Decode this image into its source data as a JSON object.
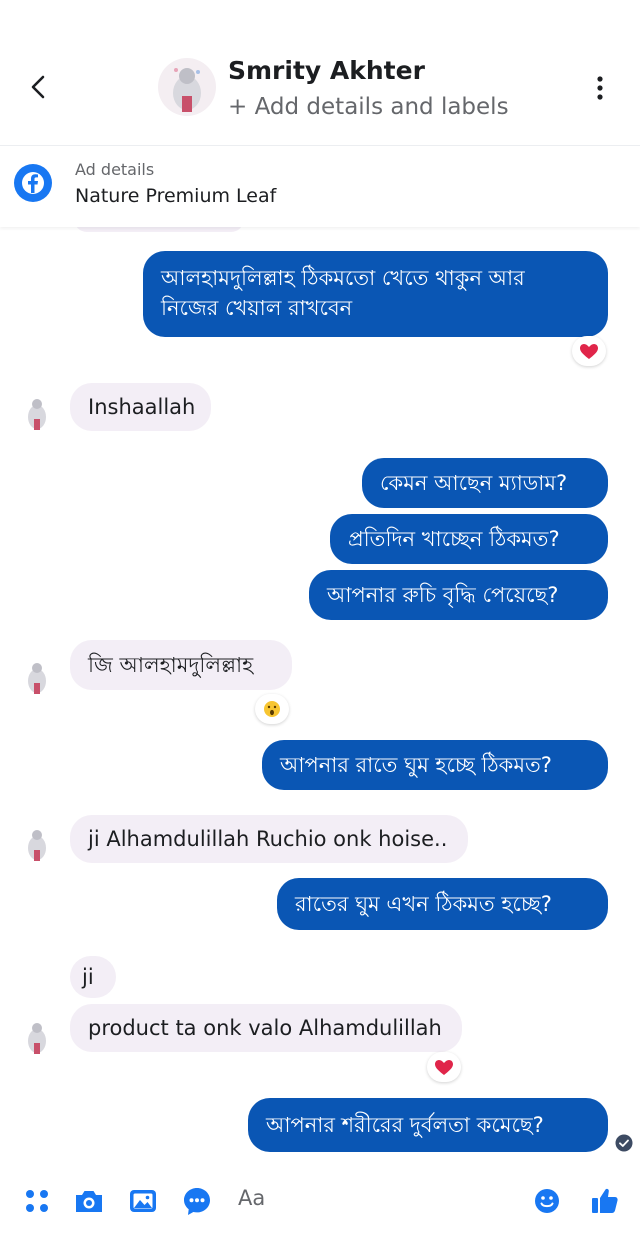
{
  "header": {
    "contact_name": "Smrity Akhter",
    "subtitle": "+ Add details and labels"
  },
  "ad": {
    "label": "Ad details",
    "title": "Nature Premium Leaf"
  },
  "messages": [
    {
      "direction": "outgoing",
      "lines": [
        "আলহামদুলিল্লাহ ঠিকমতো খেতে থাকুন আর",
        "নিজের খেয়াল রাখবেন"
      ],
      "reaction": "heart"
    },
    {
      "direction": "incoming",
      "lines": [
        "Inshaallah"
      ]
    },
    {
      "direction": "outgoing",
      "lines": [
        "কেমন আছেন ম্যাডাম?"
      ]
    },
    {
      "direction": "outgoing",
      "lines": [
        "প্রতিদিন খাচ্ছেন ঠিকমত?"
      ]
    },
    {
      "direction": "outgoing",
      "lines": [
        "আপনার রুচি বৃদ্ধি পেয়েছে?"
      ]
    },
    {
      "direction": "incoming",
      "lines": [
        "জি আলহামদুলিল্লাহ"
      ],
      "reaction": "wow"
    },
    {
      "direction": "outgoing",
      "lines": [
        "আপনার রাতে ঘুম হচ্ছে ঠিকমত?"
      ]
    },
    {
      "direction": "incoming",
      "lines": [
        "ji Alhamdulillah Ruchio onk hoise.."
      ]
    },
    {
      "direction": "outgoing",
      "lines": [
        "রাতের ঘুম এখন ঠিকমত হচ্ছে?"
      ]
    },
    {
      "direction": "incoming",
      "lines": [
        "ji"
      ]
    },
    {
      "direction": "incoming",
      "lines": [
        "product ta onk valo Alhamdulillah"
      ],
      "reaction": "heart"
    },
    {
      "direction": "outgoing",
      "lines": [
        "আপনার শরীরের দুর্বলতা কমেছে?"
      ],
      "status": "delivered"
    }
  ],
  "composer": {
    "placeholder": "Aa",
    "icons": [
      "menu-dots-icon",
      "camera-icon",
      "image-icon",
      "chat-bubble-icon",
      "emoji-icon",
      "thumbs-up-icon"
    ]
  },
  "colors": {
    "outgoing_bubble": "#0a56b4",
    "incoming_bubble": "#f3eef6",
    "accent": "#1877f2",
    "reaction_heart": "#e0254a"
  }
}
